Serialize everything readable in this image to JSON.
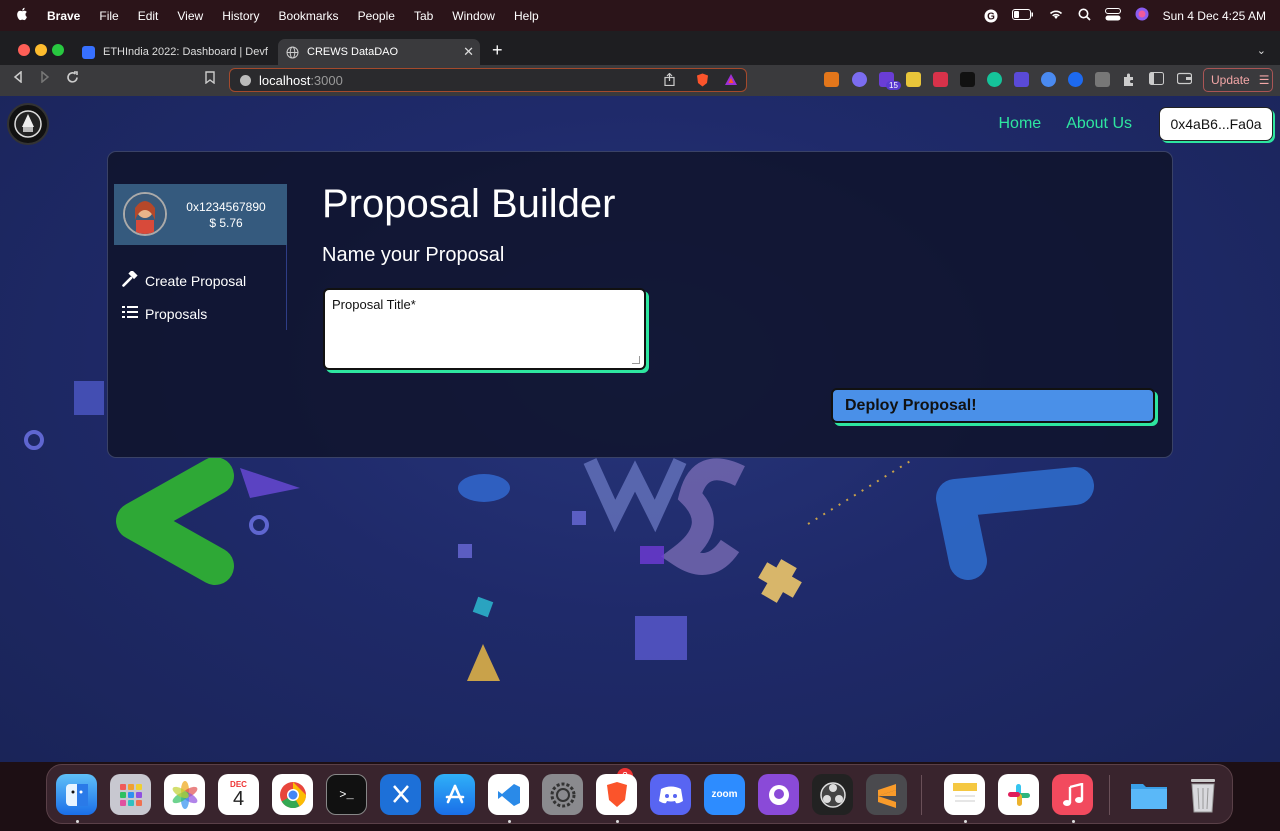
{
  "menubar": {
    "app": "Brave",
    "items": [
      "File",
      "Edit",
      "View",
      "History",
      "Bookmarks",
      "People",
      "Tab",
      "Window",
      "Help"
    ],
    "datetime": "Sun 4 Dec  4:25 AM"
  },
  "browser": {
    "tabs": [
      {
        "label": "ETHIndia 2022: Dashboard | Devfoli",
        "icon": "devfolio-icon"
      },
      {
        "label": "CREWS DataDAO",
        "icon": "globe-icon"
      }
    ],
    "url_host": "localhost",
    "url_port": ":3000",
    "update_label": "Update",
    "extension_badge": "15"
  },
  "nav": {
    "home": "Home",
    "about": "About Us",
    "wallet": "0x4aB6...Fa0a"
  },
  "sidebar": {
    "address": "0x1234567890",
    "balance": "$ 5.76",
    "items": [
      {
        "label": "Create Proposal",
        "icon": "hammer-icon"
      },
      {
        "label": "Proposals",
        "icon": "list-icon"
      }
    ]
  },
  "main": {
    "title": "Proposal Builder",
    "subtitle": "Name your Proposal",
    "title_placeholder": "Proposal Title*",
    "deploy_label": "Deploy Proposal!"
  },
  "dock": {
    "calendar_month": "DEC",
    "calendar_day": "4",
    "settings_badge": "2",
    "zoom_label": "zoom"
  },
  "colors": {
    "accent": "#2ee6a0",
    "button_blue": "#4a90e8",
    "page_bg": "#1f2a6a"
  }
}
